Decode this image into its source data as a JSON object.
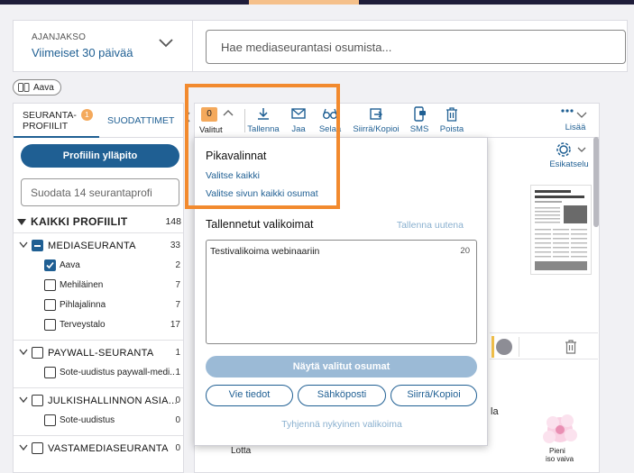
{
  "header": {
    "period_label": "AJANJAKSO",
    "period_value": "Viimeiset 30 päivää",
    "search_placeholder": "Hae mediaseurantasi osumista..."
  },
  "tag_chip": {
    "label": "Aava"
  },
  "sidebar": {
    "tab_profiles_line1": "SEURANTA-",
    "tab_profiles_line2": "PROFIILIT",
    "tab_profiles_badge": "1",
    "tab_filters": "SUODATTIMET",
    "manage_button": "Profiilin ylläpito",
    "filter_placeholder": "Suodata 14 seurantaprofi",
    "all_profiles_label": "KAIKKI PROFIILIT",
    "all_profiles_count": "148",
    "groups": [
      {
        "label": "MEDIASEURANTA",
        "count": "33",
        "state": "partial",
        "children": [
          {
            "label": "Aava",
            "count": "2",
            "checked": true
          },
          {
            "label": "Mehiläinen",
            "count": "7",
            "checked": false
          },
          {
            "label": "Pihlajalinna",
            "count": "7",
            "checked": false
          },
          {
            "label": "Terveystalo",
            "count": "17",
            "checked": false
          }
        ]
      },
      {
        "label": "PAYWALL-SEURANTA",
        "count": "1",
        "state": "unchecked",
        "children": [
          {
            "label": "Sote-uudistus paywall-medi...",
            "count": "1",
            "checked": false
          }
        ]
      },
      {
        "label": "JULKISHALLINNON ASIA...",
        "count": "0",
        "state": "unchecked",
        "children": [
          {
            "label": "Sote-uudistus",
            "count": "0",
            "checked": false
          }
        ]
      },
      {
        "label": "VASTAMEDIASEURANTA",
        "count": "0",
        "state": "unchecked",
        "children": []
      }
    ]
  },
  "toolbar": {
    "selected_count": "0",
    "selected_label": "Valitut",
    "tools": [
      {
        "label": "Tallenna",
        "icon": "download-icon"
      },
      {
        "label": "Jaa",
        "icon": "mail-icon"
      },
      {
        "label": "Selaa",
        "icon": "glasses-icon"
      },
      {
        "label": "Siirrä/Kopioi",
        "icon": "export-icon"
      },
      {
        "label": "SMS",
        "icon": "sms-icon"
      },
      {
        "label": "Poista",
        "icon": "trash-icon"
      }
    ],
    "more_label": "Lisää",
    "preview_label": "Esikatselu"
  },
  "popup": {
    "quick_title": "Pikavalinnat",
    "select_all": "Valitse kaikki",
    "select_page": "Valitse sivun kaikki osumat",
    "saved_title": "Tallennetut valikoimat",
    "save_new": "Tallenna uutena",
    "saved_items": [
      {
        "label": "Testivalikoima webinaariin",
        "count": "20"
      }
    ],
    "show_button": "Näytä valitut osumat",
    "export_button": "Vie tiedot",
    "email_button": "Sähköposti",
    "move_button": "Siirrä/Kopioi",
    "clear_link": "Tyhjennä nykyinen valikoima"
  },
  "background_text": {
    "partial_a": "la",
    "partial_b": "Lotta",
    "thumb_caption_1": "Pieni",
    "thumb_caption_2": "iso vaiva"
  },
  "colors": {
    "accent": "#1f5f93",
    "badge": "#f4a95c",
    "highlight": "#f28a2e",
    "topbar": "#1f1d3a"
  }
}
